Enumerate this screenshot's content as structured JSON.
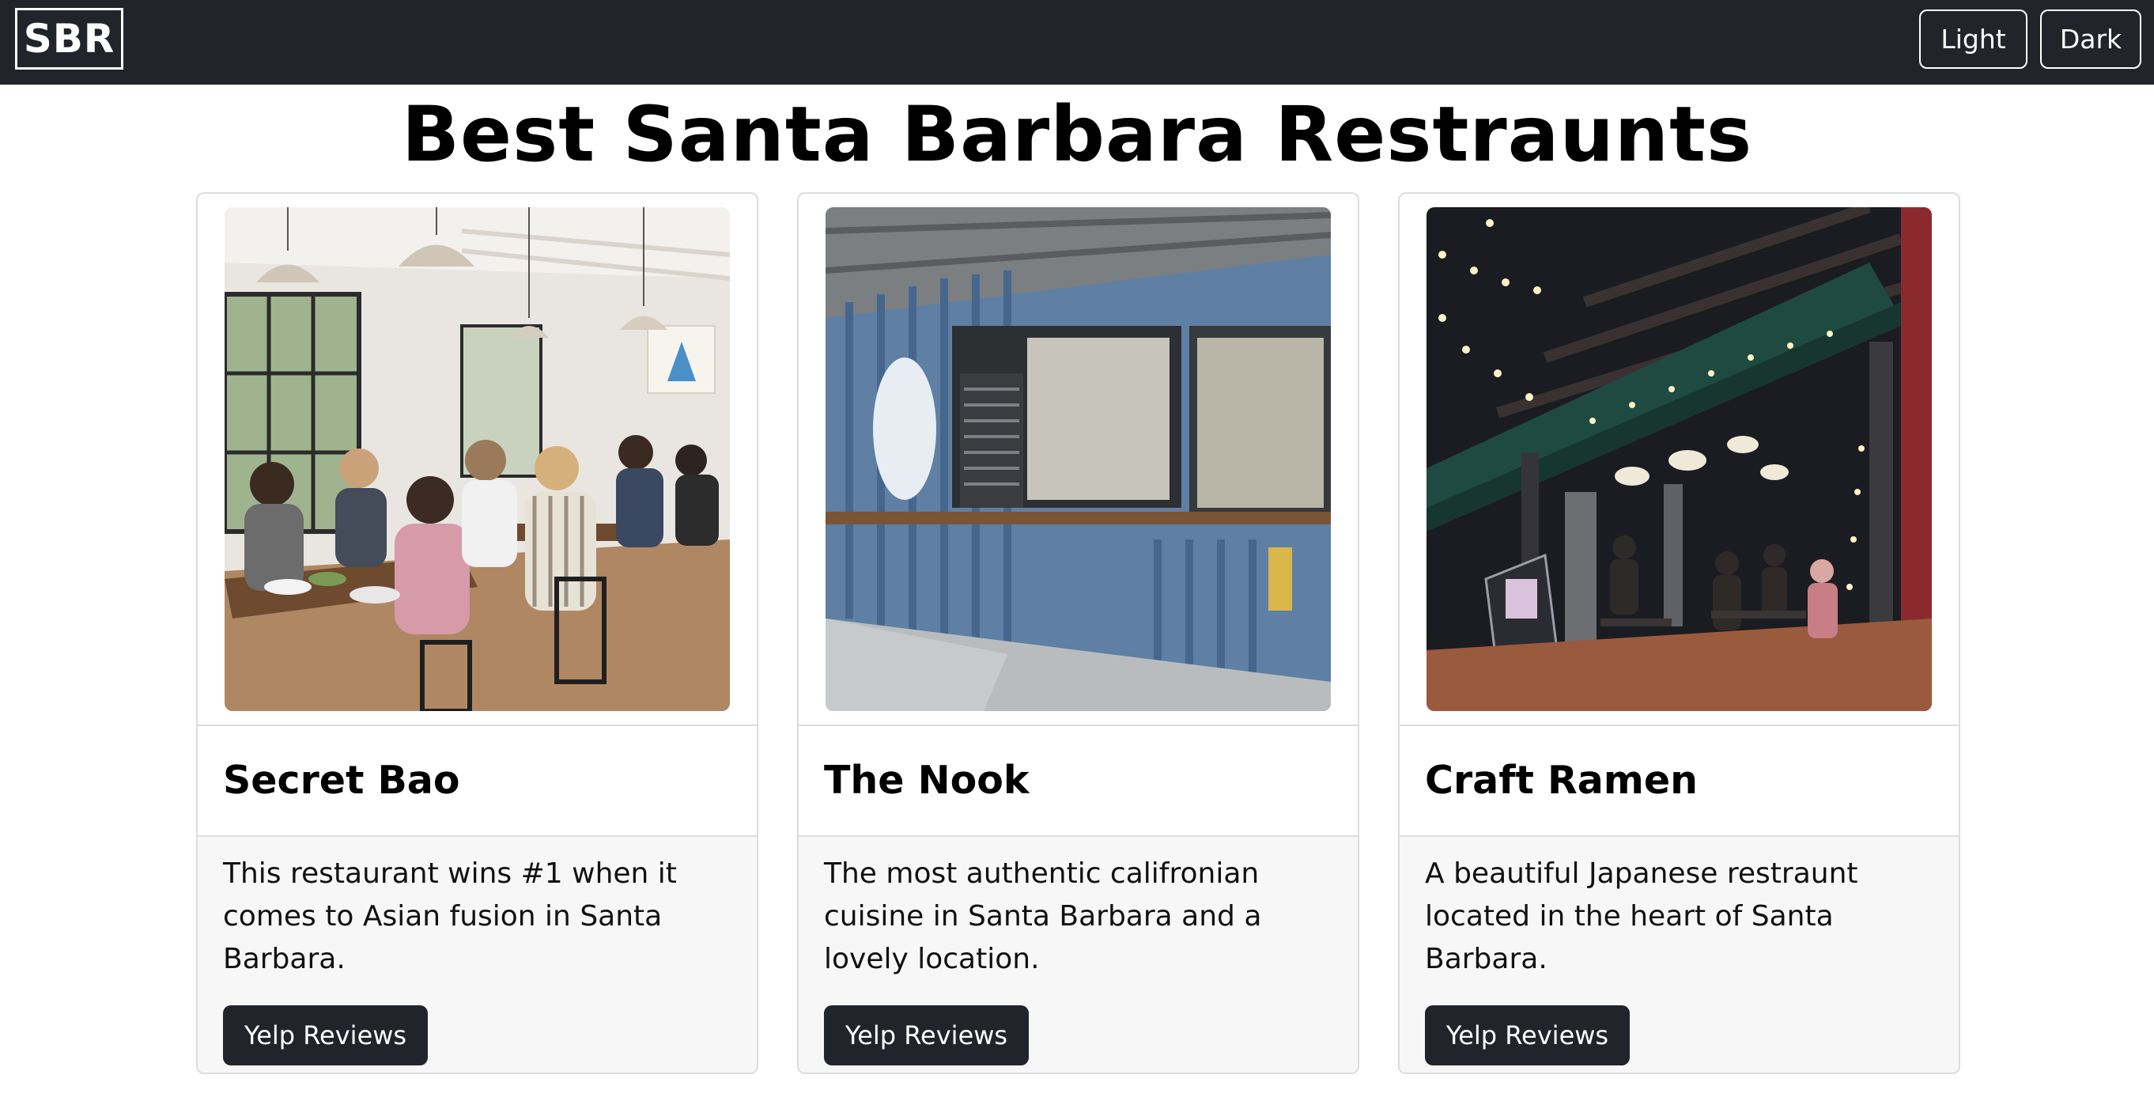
{
  "navbar": {
    "brand": "SBR",
    "theme_buttons": {
      "light_label": "Light",
      "dark_label": "Dark"
    }
  },
  "main": {
    "title": "Best Santa Barbara Restraunts",
    "cards": [
      {
        "name": "Secret Bao",
        "description": "This restaurant wins #1 when it comes to Asian fusion in Santa Barbara.",
        "button_label": "Yelp Reviews"
      },
      {
        "name": "The Nook",
        "description": "The most authentic califronian cuisine in Santa Barbara and a lovely location.",
        "button_label": "Yelp Reviews"
      },
      {
        "name": "Craft Ramen",
        "description": "A beautiful Japanese restraunt located in the heart of Santa Barbara.",
        "button_label": "Yelp Reviews"
      }
    ]
  },
  "colors": {
    "navbar_bg": "#21252b",
    "button_bg": "#21252b",
    "card_body_bg": "#f7f7f7",
    "card_border": "#dcdcdc"
  }
}
